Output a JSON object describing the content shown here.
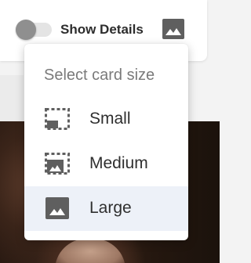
{
  "toolbar": {
    "show_details_label": "Show Details",
    "show_details_on": false
  },
  "menu": {
    "header": "Select card size",
    "items": [
      {
        "label": "Small",
        "icon": "card-size-small-icon",
        "selected": false
      },
      {
        "label": "Medium",
        "icon": "card-size-medium-icon",
        "selected": false
      },
      {
        "label": "Large",
        "icon": "card-size-large-icon",
        "selected": true
      }
    ]
  },
  "colors": {
    "icon": "#5f5f5f",
    "selected_bg": "#edf1f8",
    "toggle_knob": "#8f8f8f",
    "toggle_track": "#e4e4e4"
  }
}
